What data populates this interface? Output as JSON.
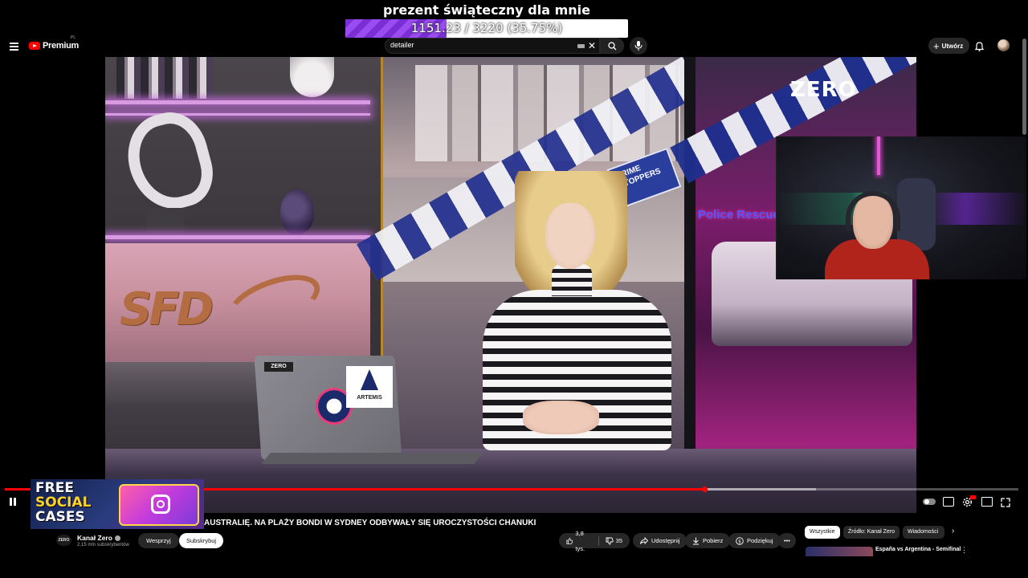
{
  "goal": {
    "title": "prezent świąteczny dla mnie",
    "text": "1151.23 / 3220 (35.75%)",
    "progress_fraction": 0.3575
  },
  "header": {
    "logo_text": "Premium",
    "logo_region": "PL",
    "search_value": "detailer",
    "create_label": "Utwórz"
  },
  "video": {
    "studio_logo": "SFD",
    "channel_watermark": "ZERO",
    "laptop_sticker": "ZERO",
    "artemis_sticker": "ARTEMIS",
    "crime_sign": "CRIME STOPPERS",
    "police_rescue": "Police Rescue",
    "progress_fraction": 0.69,
    "buffered_fraction": 0.8
  },
  "promo": {
    "line1": "FREE",
    "line2": "SOCIAL",
    "line3": "CASES"
  },
  "info": {
    "title": "AUSTRALIĘ. NA PLAŻY BONDI W SYDNEY ODBYWAŁY SIĘ UROCZYSTOŚCI CHANUKI",
    "channel_avatar_text": "ZERO",
    "channel_name": "Kanał Zero",
    "subscribers": "2,15 mln subskrybentów",
    "support_label": "Wesprzyj",
    "subscribe_label": "Subskrybuj",
    "likes": "3,8 tys.",
    "dislikes": "35",
    "share_label": "Udostępnij",
    "download_label": "Pobierz",
    "thanks_label": "Podziękuj"
  },
  "sidebar": {
    "chips": [
      "Wszystkie",
      "Źródło: Kanał Zero",
      "Wiadomości"
    ],
    "recommended_title": "España vs Argentina - Semifinal"
  },
  "colors": {
    "accent": "#ff0000",
    "goal_fill": "#7a2fd6",
    "background": "#000000"
  }
}
